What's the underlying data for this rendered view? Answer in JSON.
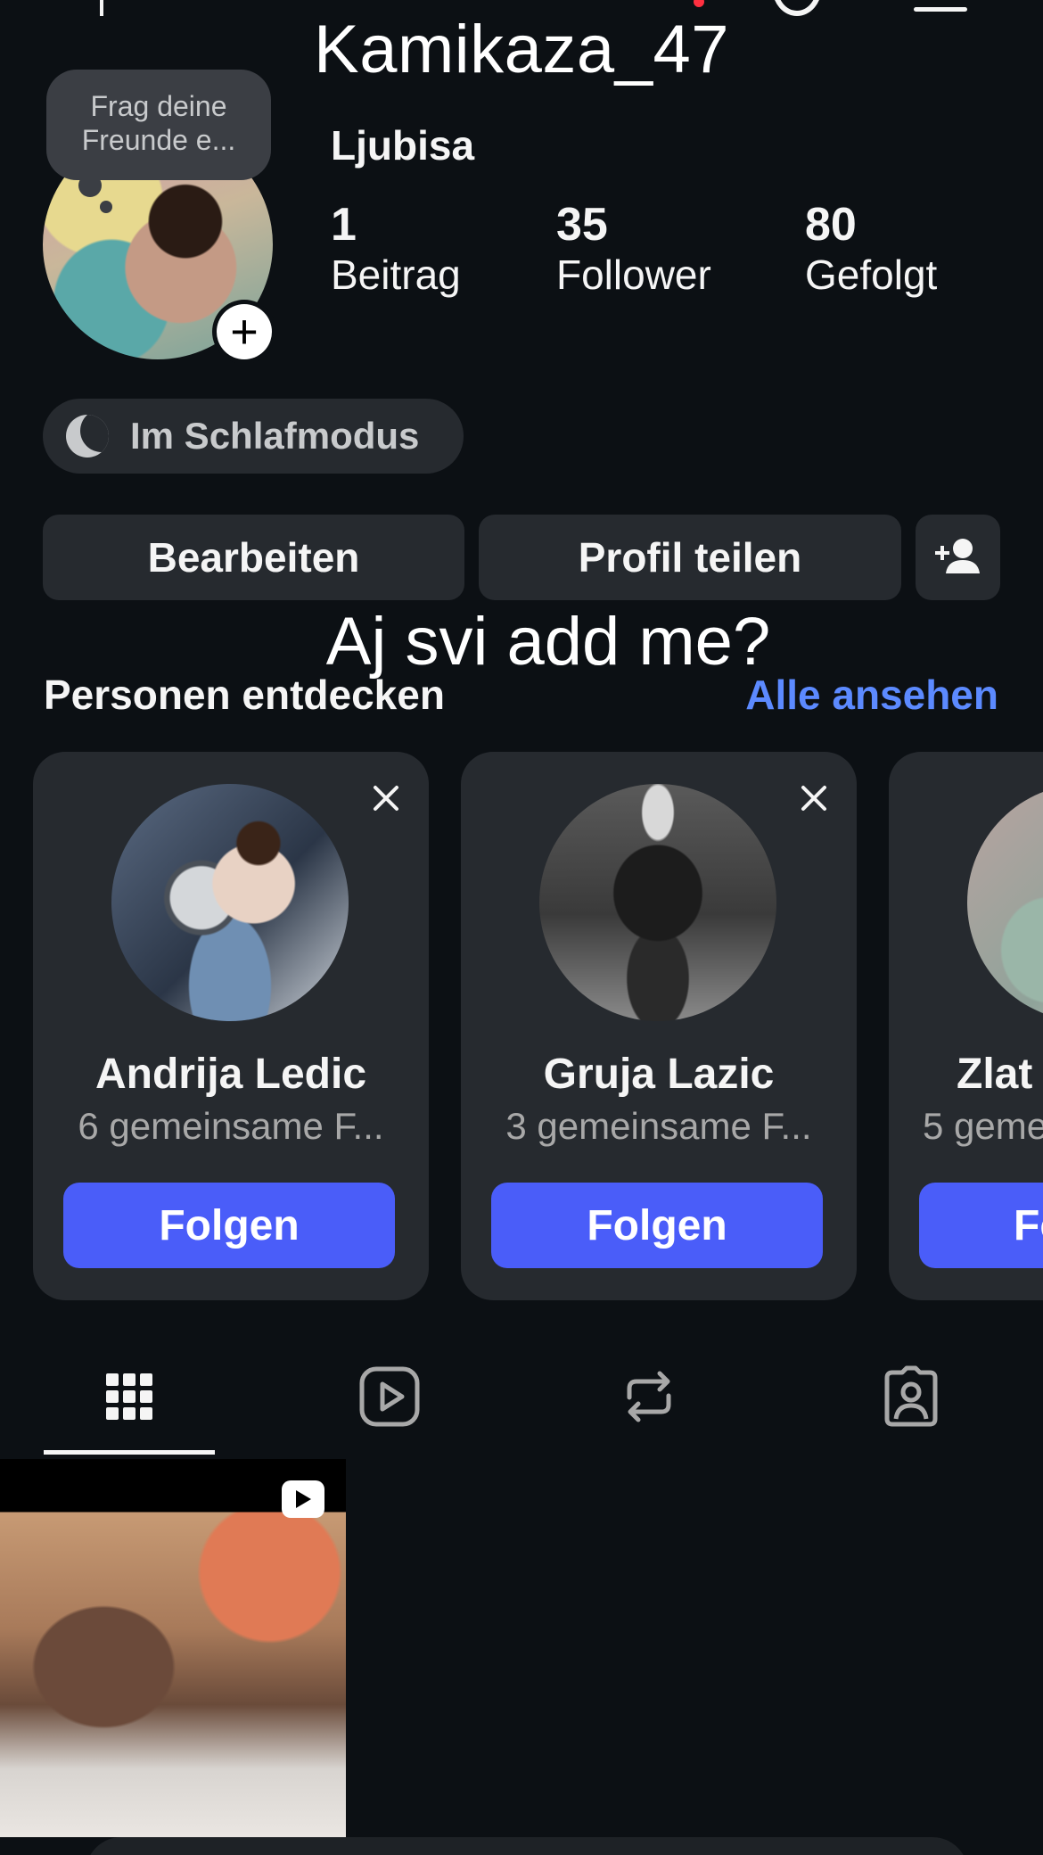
{
  "header": {
    "username_truncated": "Kamika...",
    "display_overlay": "Kamikaza_47"
  },
  "profile": {
    "note": "Frag deine Freunde e...",
    "full_name": "Ljubisa",
    "stats": [
      {
        "value": "1",
        "label": "Beitrag"
      },
      {
        "value": "35",
        "label": "Follower"
      },
      {
        "value": "80",
        "label": "Gefolgt"
      }
    ],
    "status": "Im Schlafmodus",
    "bio_overlay": "Aj svi add me?"
  },
  "actions": {
    "edit": "Bearbeiten",
    "share": "Profil teilen"
  },
  "discover": {
    "title": "Personen entdecken",
    "see_all": "Alle ansehen",
    "cards": [
      {
        "name": "Andrija Ledic",
        "mutual": "6 gemeinsame F...",
        "follow": "Folgen"
      },
      {
        "name": "Gruja Lazic",
        "mutual": "3 gemeinsame F...",
        "follow": "Folgen"
      },
      {
        "name": "Zlat",
        "mutual": "5 geme",
        "follow": "Fo"
      }
    ]
  },
  "tabs": [
    "grid-icon",
    "reels-icon",
    "reposts-icon",
    "tagged-icon"
  ],
  "colors": {
    "background": "#0c1014",
    "surface": "#262a2f",
    "accent": "#4a5df9",
    "link": "#5c8aff"
  }
}
